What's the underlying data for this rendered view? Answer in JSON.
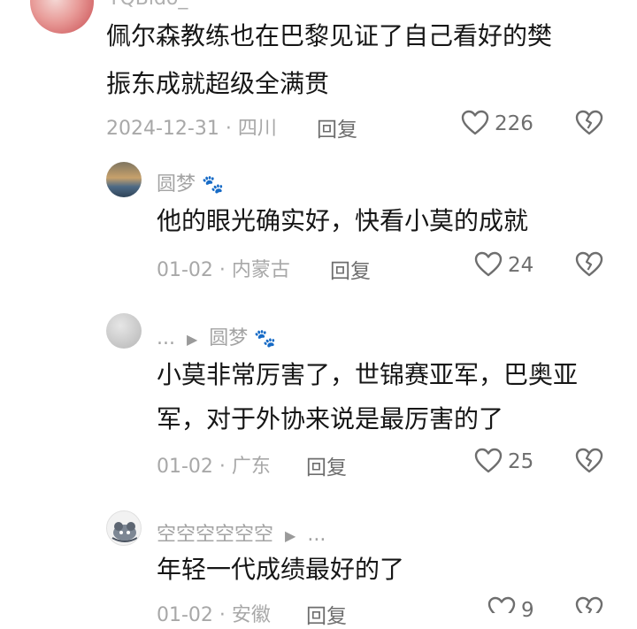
{
  "comments": [
    {
      "username": "YQBldo_",
      "text_line1": "佩尔森教练也在巴黎见证了自己看好的樊",
      "text_line2": "振东成就超级全满贯",
      "date": "2024-12-31",
      "location": "四川",
      "reply_label": "回复",
      "likes": "226"
    },
    {
      "username": "圆梦",
      "text_line1": "他的眼光确实好，快看小莫的成就",
      "date": "01-02",
      "location": "内蒙古",
      "reply_label": "回复",
      "likes": "24"
    },
    {
      "username_prefix": "...",
      "reply_to": "圆梦",
      "text_line1": "小莫非常厉害了，世锦赛亚军，巴奥亚",
      "text_line2": "军，对于外协来说是最厉害的了",
      "date": "01-02",
      "location": "广东",
      "reply_label": "回复",
      "likes": "25"
    },
    {
      "username": "空空空空空空",
      "reply_suffix": "...",
      "text_line1": "年轻一代成绩最好的了",
      "date": "01-02",
      "location": "安徽",
      "reply_label": "回复",
      "likes": "9"
    }
  ],
  "separator": " · ",
  "colors": {
    "meta_gray": "#a8a8a8",
    "text": "#161616",
    "icon": "#6e6e6e"
  }
}
